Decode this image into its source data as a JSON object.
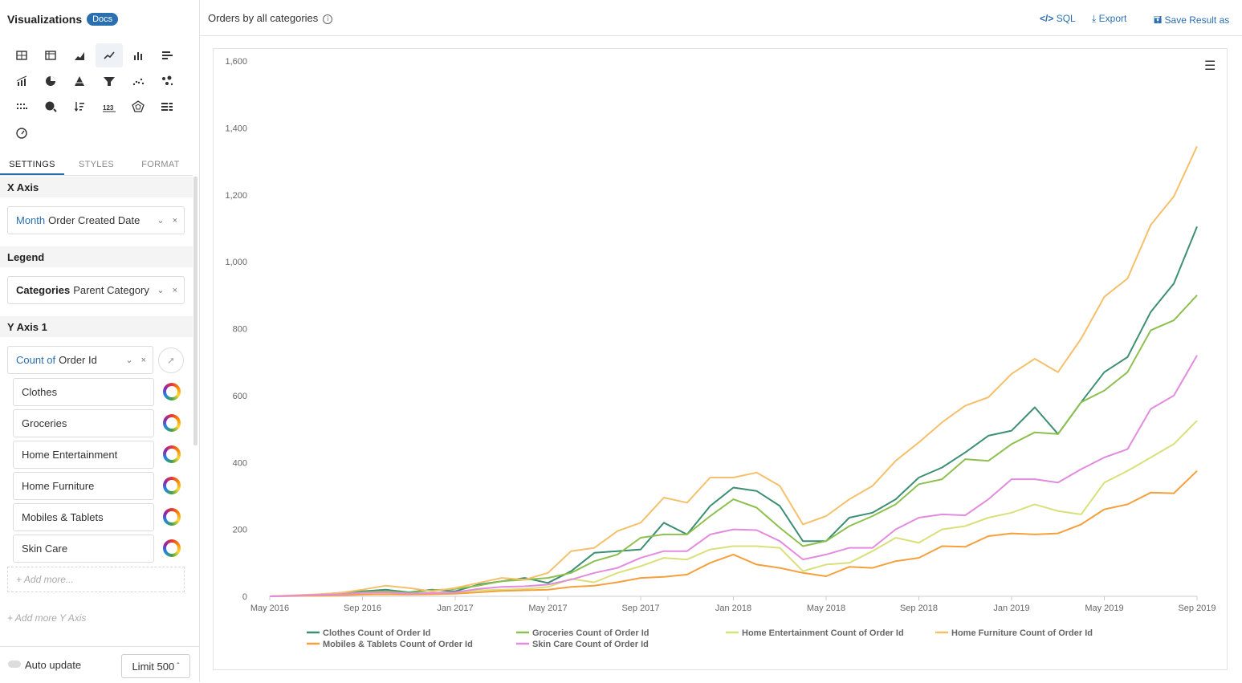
{
  "sidebar": {
    "title": "Visualizations",
    "docs_badge": "Docs",
    "tabs": [
      "SETTINGS",
      "STYLES",
      "FORMAT"
    ],
    "x_axis": {
      "header": "X Axis",
      "prefix": "Month",
      "field": "Order Created Date"
    },
    "legend": {
      "header": "Legend",
      "prefix": "Categories",
      "field": "Parent Category"
    },
    "y_axis": {
      "header": "Y Axis 1",
      "prefix": "Count of",
      "field": "Order Id",
      "categories": [
        "Clothes",
        "Groceries",
        "Home Entertainment",
        "Home Furniture",
        "Mobiles & Tablets",
        "Skin Care"
      ],
      "add_more": "+ Add more...",
      "add_y_axis": "+ Add more Y Axis"
    },
    "auto_update": "Auto update",
    "limit": "Limit 500"
  },
  "topbar": {
    "title": "Orders by all categories",
    "sql": "SQL",
    "export": "Export",
    "save": "Save Result as"
  },
  "chart_data": {
    "type": "line",
    "x": [
      "May 2016",
      "Jun 2016",
      "Jul 2016",
      "Aug 2016",
      "Sep 2016",
      "Oct 2016",
      "Nov 2016",
      "Dec 2016",
      "Jan 2017",
      "Feb 2017",
      "Mar 2017",
      "Apr 2017",
      "May 2017",
      "Jun 2017",
      "Jul 2017",
      "Aug 2017",
      "Sep 2017",
      "Oct 2017",
      "Nov 2017",
      "Dec 2017",
      "Jan 2018",
      "Feb 2018",
      "Mar 2018",
      "Apr 2018",
      "May 2018",
      "Jun 2018",
      "Jul 2018",
      "Aug 2018",
      "Sep 2018",
      "Oct 2018",
      "Nov 2018",
      "Dec 2018",
      "Jan 2019",
      "Feb 2019",
      "Mar 2019",
      "Apr 2019",
      "May 2019",
      "Jun 2019",
      "Jul 2019",
      "Aug 2019",
      "Sep 2019"
    ],
    "x_tick_labels": [
      "May 2016",
      "Sep 2016",
      "Jan 2017",
      "May 2017",
      "Sep 2017",
      "Jan 2018",
      "May 2018",
      "Sep 2018",
      "Jan 2019",
      "May 2019",
      "Sep 2019"
    ],
    "y_tick_labels": [
      "0",
      "200",
      "400",
      "600",
      "800",
      "1,000",
      "1,200",
      "1,400",
      "1,600"
    ],
    "ylim": [
      0,
      1600
    ],
    "legend_position": "bottom",
    "series": [
      {
        "name": "Clothes Count of Order Id",
        "color": "#3d8f73",
        "values": [
          0,
          2,
          5,
          10,
          15,
          20,
          12,
          20,
          15,
          35,
          45,
          55,
          40,
          75,
          130,
          135,
          140,
          220,
          185,
          270,
          325,
          315,
          270,
          165,
          165,
          235,
          250,
          290,
          355,
          385,
          430,
          480,
          495,
          565,
          485,
          580,
          670,
          715,
          850,
          935,
          1105
        ]
      },
      {
        "name": "Groceries Count of Order Id",
        "color": "#8dc04e",
        "values": [
          0,
          2,
          5,
          8,
          12,
          15,
          10,
          18,
          22,
          32,
          45,
          50,
          55,
          70,
          105,
          125,
          175,
          185,
          185,
          240,
          290,
          265,
          205,
          150,
          165,
          210,
          240,
          275,
          335,
          350,
          410,
          405,
          455,
          490,
          485,
          580,
          615,
          670,
          795,
          825,
          900
        ]
      },
      {
        "name": "Home Entertainment Count of Order Id",
        "color": "#d9e07a",
        "values": [
          0,
          1,
          2,
          3,
          5,
          8,
          6,
          8,
          10,
          18,
          20,
          22,
          28,
          52,
          42,
          70,
          90,
          115,
          110,
          140,
          150,
          150,
          145,
          75,
          95,
          100,
          135,
          175,
          160,
          200,
          210,
          235,
          250,
          275,
          255,
          245,
          340,
          375,
          415,
          455,
          525
        ]
      },
      {
        "name": "Home Furniture Count of Order Id",
        "color": "#f5c06b",
        "values": [
          0,
          3,
          6,
          10,
          20,
          32,
          25,
          15,
          25,
          40,
          55,
          50,
          70,
          135,
          145,
          195,
          220,
          295,
          280,
          355,
          355,
          370,
          330,
          215,
          240,
          290,
          330,
          405,
          460,
          520,
          570,
          595,
          665,
          710,
          670,
          770,
          895,
          950,
          1110,
          1195,
          1345
        ]
      },
      {
        "name": "Mobiles & Tablets Count of Order Id",
        "color": "#f5a03c",
        "values": [
          0,
          1,
          2,
          3,
          5,
          6,
          5,
          6,
          8,
          12,
          16,
          18,
          20,
          28,
          32,
          42,
          55,
          58,
          65,
          100,
          125,
          95,
          85,
          70,
          60,
          88,
          85,
          105,
          115,
          150,
          148,
          180,
          188,
          185,
          188,
          215,
          260,
          275,
          310,
          308,
          375
        ]
      },
      {
        "name": "Skin Care Count of Order Id",
        "color": "#e38bde",
        "values": [
          0,
          2,
          4,
          6,
          10,
          12,
          8,
          10,
          12,
          22,
          28,
          30,
          35,
          50,
          70,
          85,
          115,
          135,
          135,
          185,
          200,
          198,
          165,
          110,
          125,
          145,
          145,
          200,
          235,
          245,
          242,
          290,
          350,
          350,
          340,
          380,
          415,
          440,
          560,
          600,
          720
        ]
      }
    ]
  }
}
